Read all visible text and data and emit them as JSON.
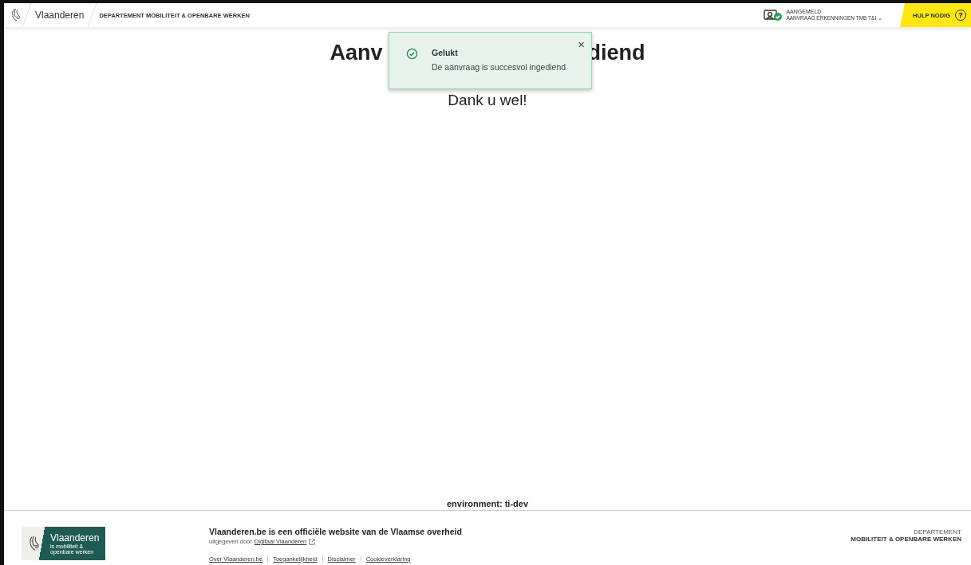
{
  "header": {
    "brand": "Vlaanderen",
    "department": "DEPARTEMENT MOBILITEIT & OPENBARE WERKEN",
    "user": {
      "status": "AANGEMELD",
      "role": "AANVRAAG ERKENNINGEN TMB T&I",
      "caret": "⌄"
    },
    "help": "HULP NODIG",
    "help_symbol": "?"
  },
  "main": {
    "heading_parts": [
      "Aanv",
      "diend"
    ],
    "subtitle": "Dank u wel!",
    "environment": "environment: ti-dev"
  },
  "toast": {
    "kind": "success",
    "title": "Gelukt",
    "message": "De aanvraag is succesvol ingediend",
    "close": "×"
  },
  "footer": {
    "logo": {
      "name": "Vlaanderen",
      "tagline": "is mobiliteit & openbare werken"
    },
    "statement": "Vlaanderen.be is een officiële website van de Vlaamse overheid",
    "published_by": "uitgegeven door",
    "publisher_link": "Digitaal Vlaanderen",
    "links": [
      "Over Vlaanderen.be",
      "Toegankelijkheid",
      "Disclaimer",
      "Cookieverklaring"
    ],
    "department_label": "DEPARTEMENT",
    "department_name": "MOBILITEIT & OPENBARE WERKEN"
  }
}
